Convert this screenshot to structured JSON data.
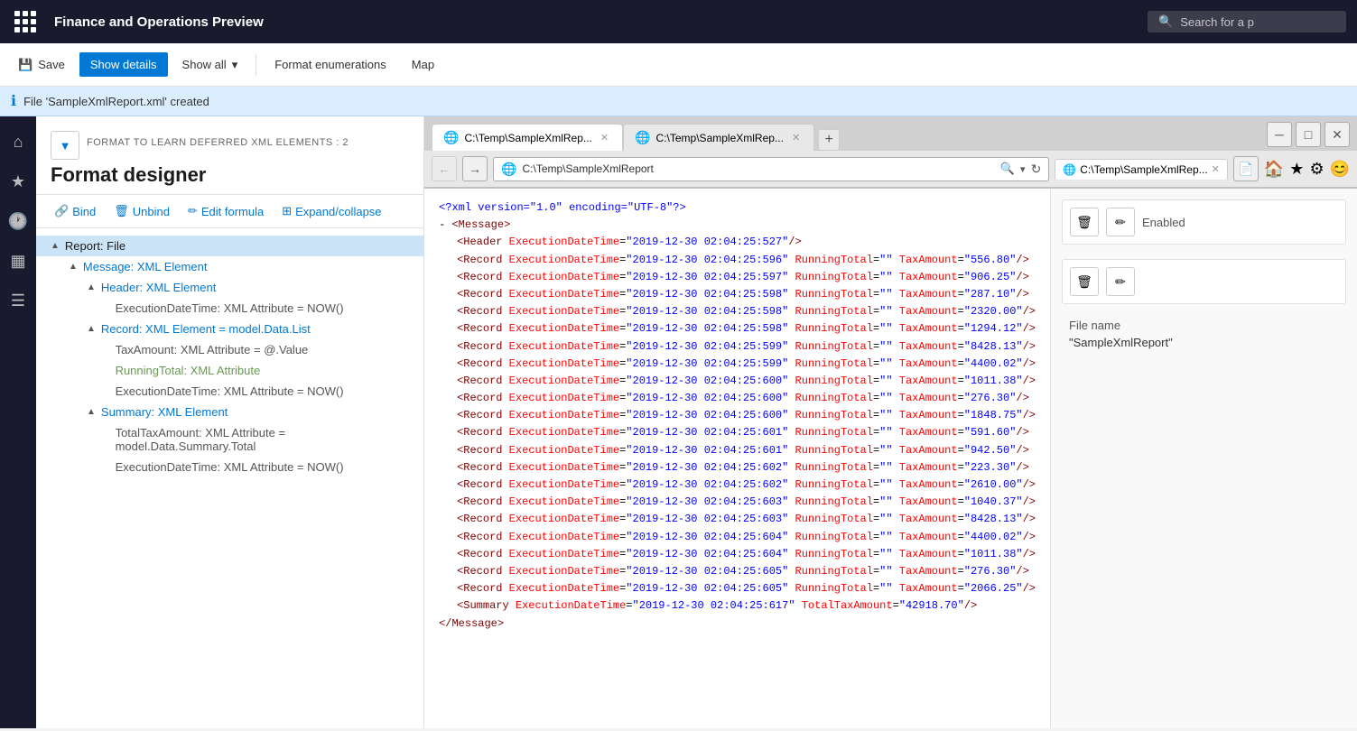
{
  "appBar": {
    "title": "Finance and Operations Preview",
    "searchPlaceholder": "Search for a p"
  },
  "toolbar": {
    "saveLabel": "Save",
    "showDetailsLabel": "Show details",
    "showAllLabel": "Show all",
    "formatEnumerationsLabel": "Format enumerations",
    "mapLabel": "Map"
  },
  "infoBar": {
    "message": "File 'SampleXmlReport.xml' created"
  },
  "leftPanel": {
    "formatLabel": "FORMAT TO LEARN DEFERRED XML ELEMENTS : 2",
    "formatTitle": "Format designer",
    "tools": {
      "bind": "Bind",
      "unbind": "Unbind",
      "editFormula": "Edit formula",
      "expandCollapse": "Expand/collapse"
    },
    "tree": [
      {
        "level": 1,
        "chevron": "▲",
        "label": "Report: File",
        "type": "root"
      },
      {
        "level": 2,
        "chevron": "▲",
        "label": "Message: XML Element",
        "type": "element"
      },
      {
        "level": 3,
        "chevron": "▲",
        "label": "Header: XML Element",
        "type": "element"
      },
      {
        "level": 4,
        "chevron": "",
        "label": "ExecutionDateTime: XML Attribute = NOW()",
        "type": "attribute"
      },
      {
        "level": 3,
        "chevron": "▲",
        "label": "Record: XML Element = model.Data.List",
        "type": "element"
      },
      {
        "level": 4,
        "chevron": "",
        "label": "TaxAmount: XML Attribute = @.Value",
        "type": "attribute"
      },
      {
        "level": 4,
        "chevron": "",
        "label": "RunningTotal: XML Attribute",
        "type": "attribute-plain"
      },
      {
        "level": 4,
        "chevron": "",
        "label": "ExecutionDateTime: XML Attribute = NOW()",
        "type": "attribute"
      },
      {
        "level": 3,
        "chevron": "▲",
        "label": "Summary: XML Element",
        "type": "element"
      },
      {
        "level": 4,
        "chevron": "",
        "label": "TotalTaxAmount: XML Attribute = model.Data.Summary.Total",
        "type": "attribute"
      },
      {
        "level": 4,
        "chevron": "",
        "label": "ExecutionDateTime: XML Attribute = NOW()",
        "type": "attribute"
      }
    ]
  },
  "browser": {
    "addressUrl": "C:\\Temp\\SampleXmlReport",
    "addressUrl2": "C:\\Temp\\SampleXmlRep...",
    "tabLabel": "C:\\Temp\\SampleXmlRep...",
    "tabLabel2": "C:\\Temp\\SampleXmlRep..."
  },
  "xmlContent": {
    "declaration": "<?xml version=\"1.0\" encoding=\"UTF-8\"?>",
    "lines": [
      {
        "indent": 0,
        "text": "<Message>"
      },
      {
        "indent": 1,
        "text": "<Header ExecutionDateTime=\"2019-12-30 02:04:25:527\"/>"
      },
      {
        "indent": 1,
        "text": "<Record ExecutionDateTime=\"2019-12-30 02:04:25:596\" RunningTotal=\"\" TaxAmount=\"556.80\"/>"
      },
      {
        "indent": 1,
        "text": "<Record ExecutionDateTime=\"2019-12-30 02:04:25:597\" RunningTotal=\"\" TaxAmount=\"906.25\"/>"
      },
      {
        "indent": 1,
        "text": "<Record ExecutionDateTime=\"2019-12-30 02:04:25:598\" RunningTotal=\"\" TaxAmount=\"287.10\"/>"
      },
      {
        "indent": 1,
        "text": "<Record ExecutionDateTime=\"2019-12-30 02:04:25:598\" RunningTotal=\"\" TaxAmount=\"2320.00\"/>"
      },
      {
        "indent": 1,
        "text": "<Record ExecutionDateTime=\"2019-12-30 02:04:25:598\" RunningTotal=\"\" TaxAmount=\"1294.12\"/>"
      },
      {
        "indent": 1,
        "text": "<Record ExecutionDateTime=\"2019-12-30 02:04:25:599\" RunningTotal=\"\" TaxAmount=\"8428.13\"/>"
      },
      {
        "indent": 1,
        "text": "<Record ExecutionDateTime=\"2019-12-30 02:04:25:599\" RunningTotal=\"\" TaxAmount=\"4400.02\"/>"
      },
      {
        "indent": 1,
        "text": "<Record ExecutionDateTime=\"2019-12-30 02:04:25:600\" RunningTotal=\"\" TaxAmount=\"1011.38\"/>"
      },
      {
        "indent": 1,
        "text": "<Record ExecutionDateTime=\"2019-12-30 02:04:25:600\" RunningTotal=\"\" TaxAmount=\"276.30\"/>"
      },
      {
        "indent": 1,
        "text": "<Record ExecutionDateTime=\"2019-12-30 02:04:25:600\" RunningTotal=\"\" TaxAmount=\"1848.75\"/>"
      },
      {
        "indent": 1,
        "text": "<Record ExecutionDateTime=\"2019-12-30 02:04:25:601\" RunningTotal=\"\" TaxAmount=\"591.60\"/>"
      },
      {
        "indent": 1,
        "text": "<Record ExecutionDateTime=\"2019-12-30 02:04:25:601\" RunningTotal=\"\" TaxAmount=\"942.50\"/>"
      },
      {
        "indent": 1,
        "text": "<Record ExecutionDateTime=\"2019-12-30 02:04:25:602\" RunningTotal=\"\" TaxAmount=\"223.30\"/>"
      },
      {
        "indent": 1,
        "text": "<Record ExecutionDateTime=\"2019-12-30 02:04:25:602\" RunningTotal=\"\" TaxAmount=\"2610.00\"/>"
      },
      {
        "indent": 1,
        "text": "<Record ExecutionDateTime=\"2019-12-30 02:04:25:603\" RunningTotal=\"\" TaxAmount=\"1040.37\"/>"
      },
      {
        "indent": 1,
        "text": "<Record ExecutionDateTime=\"2019-12-30 02:04:25:603\" RunningTotal=\"\" TaxAmount=\"8428.13\"/>"
      },
      {
        "indent": 1,
        "text": "<Record ExecutionDateTime=\"2019-12-30 02:04:25:604\" RunningTotal=\"\" TaxAmount=\"4400.02\"/>"
      },
      {
        "indent": 1,
        "text": "<Record ExecutionDateTime=\"2019-12-30 02:04:25:604\" RunningTotal=\"\" TaxAmount=\"1011.38\"/>"
      },
      {
        "indent": 1,
        "text": "<Record ExecutionDateTime=\"2019-12-30 02:04:25:605\" RunningTotal=\"\" TaxAmount=\"276.30\"/>"
      },
      {
        "indent": 1,
        "text": "<Record ExecutionDateTime=\"2019-12-30 02:04:25:605\" RunningTotal=\"\" TaxAmount=\"2066.25\"/>"
      },
      {
        "indent": 1,
        "text": "<Summary ExecutionDateTime=\"2019-12-30 02:04:25:617\" TotalTaxAmount=\"42918.70\"/>"
      },
      {
        "indent": 0,
        "text": "</Message>"
      }
    ]
  },
  "propertiesPanel": {
    "enabled": {
      "label": "Enabled"
    },
    "fileName": {
      "label": "File name",
      "value": "\"SampleXmlReport\""
    }
  }
}
